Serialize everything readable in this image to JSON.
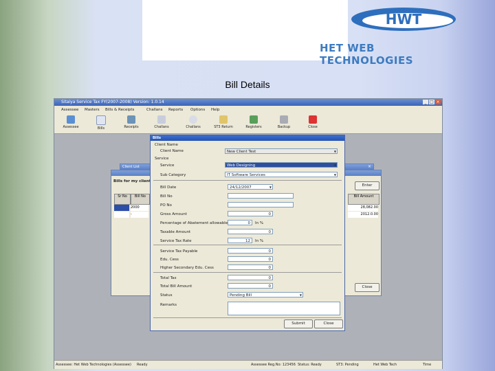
{
  "logo": {
    "mark": "HWT",
    "company": "HET WEB TECHNOLOGIES"
  },
  "slide": {
    "title": "Bill Details"
  },
  "app": {
    "title": "Sitaiya Service Tax FY(2007-2008) Version: 1.0.14",
    "menu": [
      "Assessee",
      "Masters",
      "Bills & Receipts",
      "Challans",
      "Reports",
      "Options",
      "Help"
    ],
    "toolbar": [
      "Assessee",
      "Bills",
      "Receipts",
      "Challans",
      "Challans",
      "ST3 Return",
      "Registers",
      "Backup",
      "Close"
    ],
    "status": [
      "Assessee: Het Web Technologies (Assessee)",
      "Ready",
      "Assessee Reg.No: 123456",
      "Status: Ready",
      "ST3: Pending",
      "Het Web Tech",
      "Time"
    ]
  },
  "client_list": {
    "title": "Client List",
    "heading": "Bills for my client",
    "col1": "Sr No",
    "col2": "Bill No",
    "rows": [
      [
        "",
        "2000"
      ],
      [
        "",
        "-"
      ]
    ],
    "right_button": "Enter",
    "r_col": "Bill Amount",
    "r_rows": [
      "28,082.00",
      "2012.0.00"
    ],
    "close_label": "Close"
  },
  "bills": {
    "title": "Bills",
    "client_section": "Client Name",
    "client_label": "Client Name",
    "client_value": "New Client Test",
    "service_section": "Service",
    "service_label": "Service",
    "service_value": "Web Designing",
    "subcategory_label": "Sub Category",
    "subcategory_value": "IT Software Services",
    "bill_date_label": "Bill Date",
    "bill_date_value": "24/12/2007",
    "bill_no_label": "Bill No",
    "bill_no_value": "",
    "po_no_label": "PO No",
    "po_no_value": "",
    "gross_amount_label": "Gross Amount",
    "gross_amount_value": "0",
    "abatement_label": "Percentage of Abatement allowable",
    "abatement_value": "0",
    "abatement_unit": "In %",
    "taxable_label": "Taxable Amount",
    "taxable_value": "0",
    "tax_rate_label": "Service Tax Rate",
    "tax_rate_value": "12",
    "tax_rate_unit": "In %",
    "service_tax_label": "Service Tax Payable",
    "service_tax_value": "0",
    "edu_cess_label": "Edu. Cess",
    "edu_cess_value": "0",
    "hedu_cess_label": "Higher Secondary Edu. Cess",
    "hedu_cess_value": "0",
    "total_tax_label": "Total Tax",
    "total_tax_value": "0",
    "total_bill_label": "Total Bill Amount",
    "total_bill_value": "0",
    "status_label": "Status",
    "status_value": "Pending Bill",
    "remarks_label": "Remarks",
    "submit_label": "Submit",
    "close_label": "Close"
  }
}
